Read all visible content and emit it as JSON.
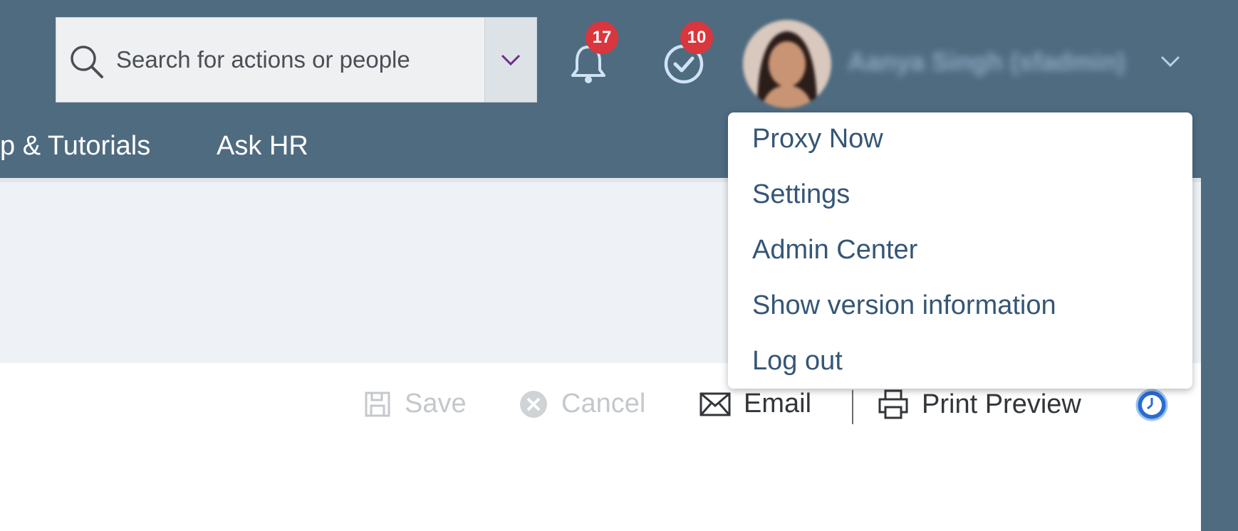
{
  "search": {
    "placeholder": "Search for actions or people"
  },
  "header": {
    "notifications": {
      "icon": "bell-icon",
      "count": "17"
    },
    "approvals": {
      "icon": "check-circle-icon",
      "count": "10"
    },
    "user": {
      "name": "Aanya Singh (sfadmin)"
    }
  },
  "nav": {
    "items": [
      {
        "label": "p & Tutorials"
      },
      {
        "label": "Ask HR"
      }
    ]
  },
  "user_menu": {
    "items": [
      {
        "label": "Proxy Now"
      },
      {
        "label": "Settings"
      },
      {
        "label": "Admin Center"
      },
      {
        "label": "Show version information"
      },
      {
        "label": "Log out"
      }
    ]
  },
  "toolbar": {
    "save_label": "Save",
    "cancel_label": "Cancel",
    "email_label": "Email",
    "print_preview_label": "Print Preview"
  },
  "colors": {
    "shell": "#4f6b80",
    "badge": "#d9363e",
    "menu_text": "#355676"
  }
}
